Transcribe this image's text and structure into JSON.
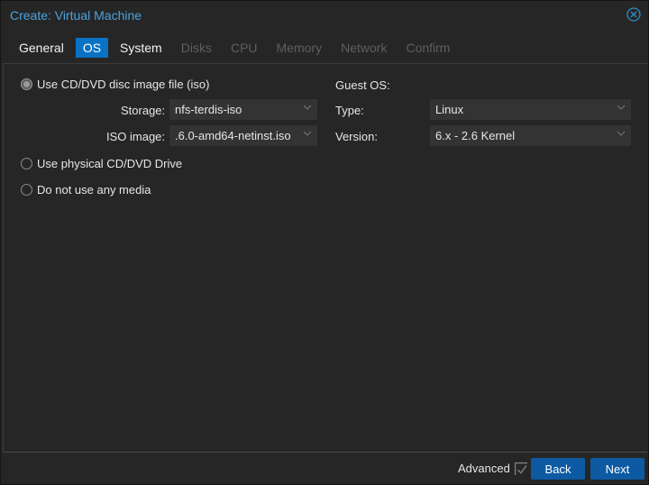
{
  "window": {
    "title": "Create: Virtual Machine",
    "close_icon": "close-circle-icon"
  },
  "tabs": [
    {
      "label": "General",
      "state": "normal"
    },
    {
      "label": "OS",
      "state": "active"
    },
    {
      "label": "System",
      "state": "normal"
    },
    {
      "label": "Disks",
      "state": "disabled"
    },
    {
      "label": "CPU",
      "state": "disabled"
    },
    {
      "label": "Memory",
      "state": "disabled"
    },
    {
      "label": "Network",
      "state": "disabled"
    },
    {
      "label": "Confirm",
      "state": "disabled"
    }
  ],
  "media": {
    "options": [
      {
        "label": "Use CD/DVD disc image file (iso)",
        "checked": true
      },
      {
        "label": "Use physical CD/DVD Drive",
        "checked": false
      },
      {
        "label": "Do not use any media",
        "checked": false
      }
    ],
    "storage_label": "Storage:",
    "storage_value": "nfs-terdis-iso",
    "iso_label": "ISO image:",
    "iso_value": ".6.0-amd64-netinst.iso"
  },
  "guest_os": {
    "heading": "Guest OS:",
    "type_label": "Type:",
    "type_value": "Linux",
    "version_label": "Version:",
    "version_value": "6.x - 2.6 Kernel"
  },
  "footer": {
    "advanced_label": "Advanced",
    "advanced_checked": true,
    "back_label": "Back",
    "next_label": "Next"
  },
  "colors": {
    "accent": "#0a72c4",
    "title": "#4aa3df",
    "button": "#0d5aa3",
    "background": "#262626"
  }
}
